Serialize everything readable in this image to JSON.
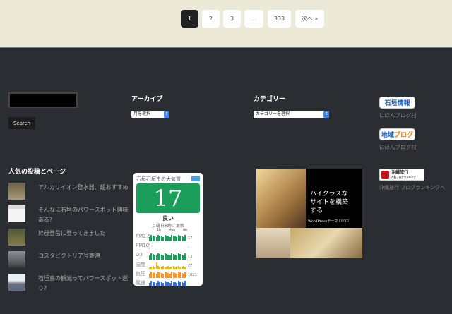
{
  "pagination": {
    "pages": [
      "1",
      "2",
      "3",
      "…",
      "333"
    ],
    "next": "次へ »",
    "current": "1"
  },
  "search": {
    "value": "",
    "button": "Search"
  },
  "archive": {
    "title": "アーカイブ",
    "select": "月を選択"
  },
  "category": {
    "title": "カテゴリー",
    "select": "カテゴリーを選択"
  },
  "popular": {
    "title": "人気の投稿とページ",
    "posts": [
      {
        "title": "アルカリイオン整水器、超おすすめ"
      },
      {
        "title": "そんなに石垣のパワースポット興味ある?"
      },
      {
        "title": "於茂登岳に登ってきました"
      },
      {
        "title": "コスタビクトリア号寄港"
      },
      {
        "title": "石垣島の観光ってパワースポット巡り?"
      }
    ]
  },
  "air": {
    "title": "石垣石垣市の大気質",
    "aqi": "17",
    "status": "良い",
    "updated": "月曜日6時に更新",
    "axis": [
      "",
      "18",
      "Mon",
      "06"
    ],
    "rows": [
      {
        "label": "PM2.5",
        "value": "17",
        "color": "#1a9e5a"
      },
      {
        "label": "PM10",
        "value": "-",
        "color": "#1a9e5a"
      },
      {
        "label": "O3",
        "value": "13",
        "color": "#1a9e5a"
      },
      {
        "label": "湿度",
        "value": "27",
        "color": "#f5b800"
      },
      {
        "label": "気圧",
        "value": "1023",
        "color": "#f7942a"
      },
      {
        "label": "風速",
        "value": "",
        "color": "#3a6fd8"
      }
    ],
    "accent": "#1a9e5a"
  },
  "ad": {
    "headline": "ハイクラスなサイトを構築する",
    "footer": "WordPressテーマ LUXE"
  },
  "badges": [
    {
      "text1": "石垣",
      "text2": "情報",
      "caption": "にほんブログ村"
    },
    {
      "text1": "地域",
      "text2": "ブログ",
      "caption": "にほんブログ村"
    },
    {
      "text1": "沖縄旅行",
      "text2": "人気ブログランキング",
      "caption": "沖縄旅行 ブログランキングへ"
    }
  ]
}
